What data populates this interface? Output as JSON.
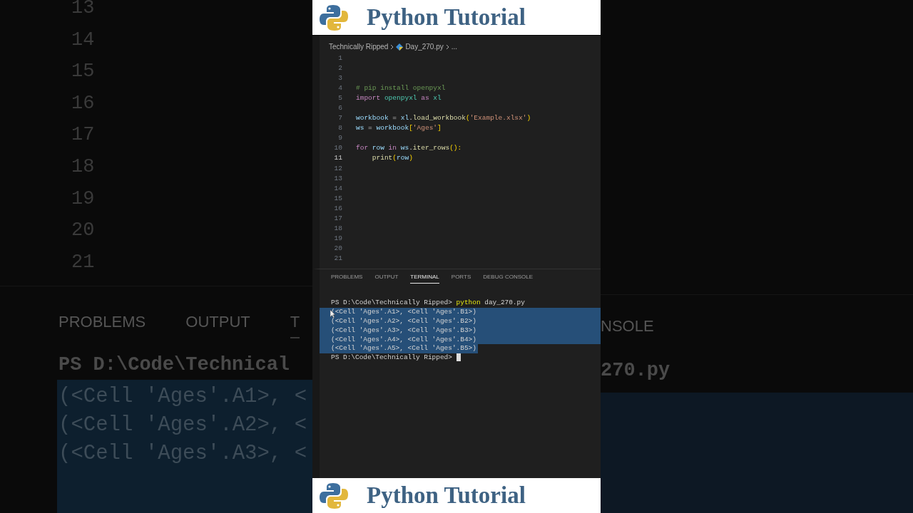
{
  "backdrop": {
    "left": {
      "line_numbers": [
        "13",
        "14",
        "15",
        "16",
        "17",
        "18",
        "19",
        "20",
        "21"
      ],
      "tabs": [
        {
          "label": "PROBLEMS",
          "selected": false
        },
        {
          "label": "OUTPUT",
          "selected": false
        },
        {
          "label": "T",
          "selected": true
        }
      ],
      "prompt": "PS D:\\Code\\Technical",
      "output_lines": [
        "(<Cell 'Ages'.A1>, <",
        "(<Cell 'Ages'.A2>, <",
        "(<Cell 'Ages'.A3>, <"
      ]
    },
    "right": {
      "tab": "NSOLE",
      "prompt_end": "270.py"
    }
  },
  "header": {
    "title": "Python Tutorial"
  },
  "breadcrumb": [
    {
      "label": "Technically Ripped",
      "kind": "folder"
    },
    {
      "label": "Day_270.py",
      "kind": "file"
    },
    {
      "label": "...",
      "kind": "more"
    }
  ],
  "editor": {
    "lines": [
      {
        "number": "1",
        "current": false
      },
      {
        "number": "2",
        "current": false
      },
      {
        "number": "3",
        "current": false
      },
      {
        "number": "4",
        "current": false,
        "tokens": [
          {
            "text": "# pip install openpyxl",
            "kind": "comment"
          }
        ]
      },
      {
        "number": "5",
        "current": false,
        "tokens": [
          {
            "text": "import",
            "kind": "keyword"
          },
          {
            "text": " openpyxl",
            "kind": "module"
          },
          {
            "text": " as",
            "kind": "keyword"
          },
          {
            "text": " xl",
            "kind": "module"
          }
        ]
      },
      {
        "number": "6",
        "current": false
      },
      {
        "number": "7",
        "current": false,
        "tokens": [
          {
            "text": "workbook",
            "kind": "variable"
          },
          {
            "text": " = ",
            "kind": "plain"
          },
          {
            "text": "xl",
            "kind": "variable"
          },
          {
            "text": ".",
            "kind": "plain"
          },
          {
            "text": "load_workbook",
            "kind": "function"
          },
          {
            "text": "(",
            "kind": "bracket"
          },
          {
            "text": "'Example.xlsx'",
            "kind": "string"
          },
          {
            "text": ")",
            "kind": "bracket"
          }
        ]
      },
      {
        "number": "8",
        "current": false,
        "tokens": [
          {
            "text": "ws",
            "kind": "variable"
          },
          {
            "text": " = ",
            "kind": "plain"
          },
          {
            "text": "workbook",
            "kind": "variable"
          },
          {
            "text": "[",
            "kind": "bracket"
          },
          {
            "text": "'Ages'",
            "kind": "string"
          },
          {
            "text": "]",
            "kind": "bracket"
          }
        ]
      },
      {
        "number": "9",
        "current": false
      },
      {
        "number": "10",
        "current": false,
        "tokens": [
          {
            "text": "for",
            "kind": "keyword"
          },
          {
            "text": " row",
            "kind": "variable"
          },
          {
            "text": " in",
            "kind": "keyword"
          },
          {
            "text": " ws",
            "kind": "variable"
          },
          {
            "text": ".",
            "kind": "plain"
          },
          {
            "text": "iter_rows",
            "kind": "function"
          },
          {
            "text": "():",
            "kind": "bracket"
          }
        ]
      },
      {
        "number": "11",
        "current": true,
        "tokens": [
          {
            "text": "    print",
            "kind": "function"
          },
          {
            "text": "(",
            "kind": "bracket"
          },
          {
            "text": "row",
            "kind": "variable"
          },
          {
            "text": ")",
            "kind": "bracket"
          }
        ]
      },
      {
        "number": "12",
        "current": false
      },
      {
        "number": "13",
        "current": false
      },
      {
        "number": "14",
        "current": false
      },
      {
        "number": "15",
        "current": false
      },
      {
        "number": "16",
        "current": false
      },
      {
        "number": "17",
        "current": false
      },
      {
        "number": "18",
        "current": false
      },
      {
        "number": "19",
        "current": false
      },
      {
        "number": "20",
        "current": false
      },
      {
        "number": "21",
        "current": false
      }
    ]
  },
  "panel": {
    "tabs": [
      {
        "label": "PROBLEMS",
        "selected": false
      },
      {
        "label": "OUTPUT",
        "selected": false
      },
      {
        "label": "TERMINAL",
        "selected": true
      },
      {
        "label": "PORTS",
        "selected": false
      },
      {
        "label": "DEBUG CONSOLE",
        "selected": false
      }
    ]
  },
  "terminal": {
    "lines": [
      {
        "selected": false,
        "cursor": false,
        "segments": [
          {
            "text": "PS D:\\Code\\Technically Ripped> ",
            "kind": "plain"
          },
          {
            "text": "python",
            "kind": "command"
          },
          {
            "text": " day_270.py",
            "kind": "plain"
          }
        ]
      },
      {
        "selected": true,
        "cursor": false,
        "segments": [
          {
            "text": "(<Cell 'Ages'.A1>, <Cell 'Ages'.B1>)",
            "kind": "plain"
          }
        ]
      },
      {
        "selected": true,
        "cursor": false,
        "segments": [
          {
            "text": "(<Cell 'Ages'.A2>, <Cell 'Ages'.B2>)",
            "kind": "plain"
          }
        ]
      },
      {
        "selected": true,
        "cursor": false,
        "segments": [
          {
            "text": "(<Cell 'Ages'.A3>, <Cell 'Ages'.B3>)",
            "kind": "plain"
          }
        ]
      },
      {
        "selected": true,
        "cursor": false,
        "segments": [
          {
            "text": "(<Cell 'Ages'.A4>, <Cell 'Ages'.B4>)",
            "kind": "plain"
          }
        ]
      },
      {
        "selected": true,
        "cursor": false,
        "segments": [
          {
            "text": "(<Cell 'Ages'.A5>, <Cell 'Ages'.B5>)",
            "kind": "plain"
          }
        ]
      },
      {
        "selected": false,
        "cursor": true,
        "segments": [
          {
            "text": "PS D:\\Code\\Technically Ripped> ",
            "kind": "plain"
          }
        ]
      }
    ]
  },
  "footer": {
    "title": "Python Tutorial"
  }
}
